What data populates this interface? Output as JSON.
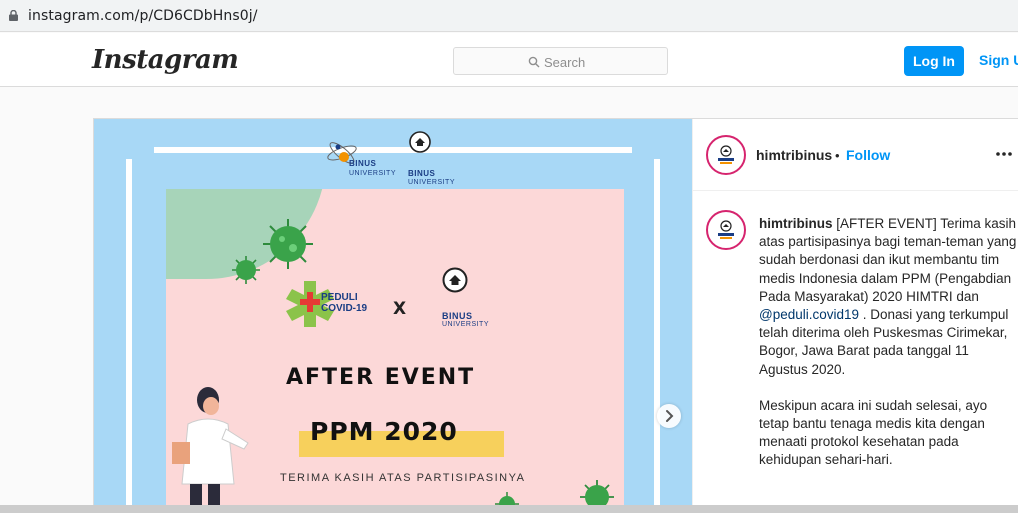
{
  "browser": {
    "url": "instagram.com/p/CD6CDbHns0j/"
  },
  "nav": {
    "logo": "Instagram",
    "search_placeholder": "Search",
    "login_label": "Log In",
    "signup_label": "Sign Up"
  },
  "post": {
    "username": "himtribinus",
    "follow_label": "Follow",
    "dot": "•",
    "caption_username": "himtribinus",
    "caption_p1_a": "[AFTER EVENT] Terima kasih atas partisipasinya bagi teman-teman yang sudah berdonasi dan ikut membantu tim medis Indonesia dalam PPM (Pengabdian Pada Masyarakat) 2020 HIMTRI dan ",
    "caption_mention": "@peduli.covid19",
    "caption_p1_b": " . Donasi yang terkumpul telah diterima oleh Puskesmas Cirimekar, Bogor, Jawa Barat pada tanggal 11 Agustus 2020.",
    "caption_p2": "Meskipun acara ini sudah selesai, ayo tetap bantu tenaga medis kita dengan menaati protokol kesehatan pada kehidupan sehari-hari."
  },
  "poster": {
    "top_binus": "BINUS",
    "top_university": "UNIVERSITY",
    "top_himtri_binus": "BINUS",
    "top_himtri_university": "UNIVERSITY",
    "peduli_line1": "PEDULI",
    "peduli_line2": "COVID-19",
    "x": "X",
    "himtri_binus": "BINUS",
    "himtri_university": "UNIVERSITY",
    "after_event": "AFTER EVENT",
    "ppm": "PPM 2020",
    "thanks": "TERIMA KASIH ATAS PARTISIPASINYA"
  },
  "colors": {
    "accent": "#0095f6",
    "poster_bg": "#fcd8d8",
    "media_bg": "#a8d8f6",
    "virus": "#3aa34a",
    "highlight": "#f7d05c"
  }
}
